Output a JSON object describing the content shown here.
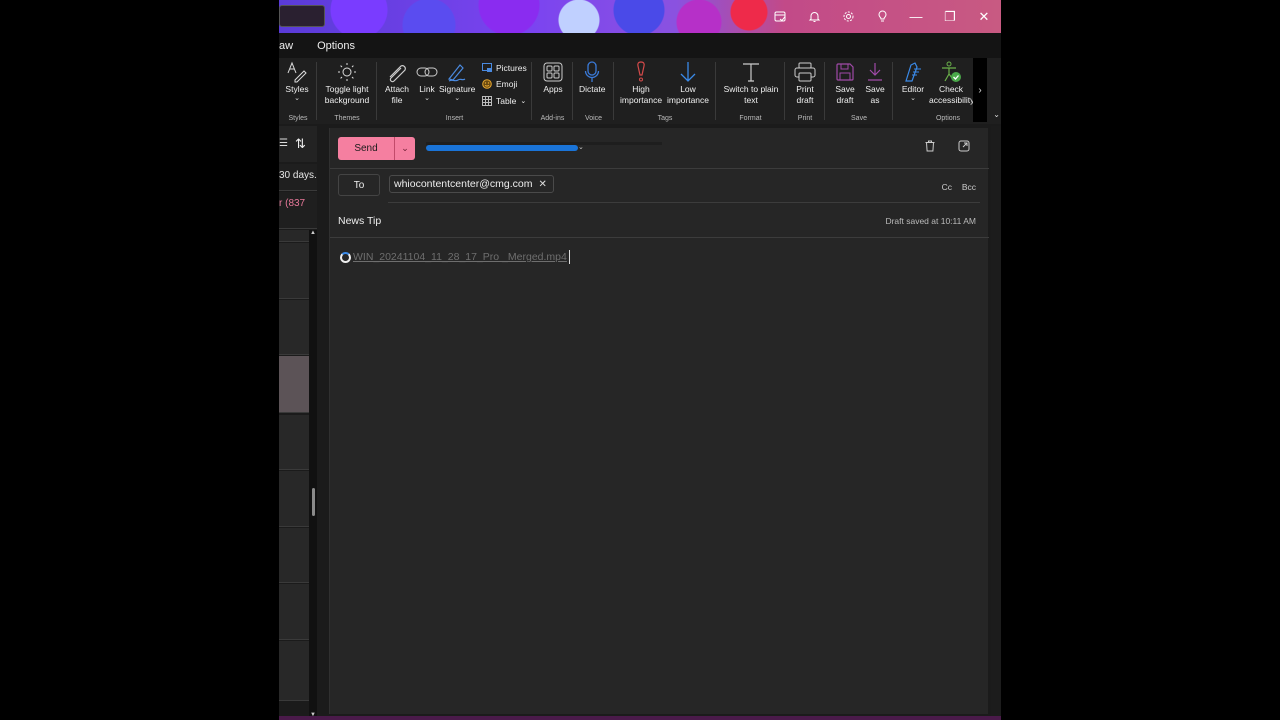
{
  "titlebar": {
    "icons": [
      {
        "name": "my-day-icon",
        "glyph": "✎"
      },
      {
        "name": "bell-icon",
        "glyph": "🔔"
      },
      {
        "name": "gear-icon",
        "glyph": "⚙"
      },
      {
        "name": "lightbulb-icon",
        "glyph": "💡"
      }
    ],
    "window_controls": {
      "minimize": "—",
      "restore": "❐",
      "close": "✕"
    }
  },
  "menubar": {
    "tabs": [
      "aw",
      "Options"
    ]
  },
  "ribbon": {
    "groups": [
      {
        "label": "Styles",
        "buttons": [
          {
            "label": "Styles",
            "icon": "styles-icon",
            "dropdown": true
          }
        ]
      },
      {
        "label": "Themes",
        "buttons": [
          {
            "label": "Toggle light background",
            "icon": "sun-icon"
          }
        ]
      },
      {
        "label": "Insert",
        "buttons": [
          {
            "label": "Attach file",
            "icon": "paperclip-icon",
            "dropdown": true
          },
          {
            "label": "Link",
            "icon": "link-icon",
            "dropdown": true
          },
          {
            "label": "Signature",
            "icon": "signature-icon",
            "dropdown": true
          },
          {
            "label": "Pictures",
            "icon": "picture-icon"
          },
          {
            "label": "Emoji",
            "icon": "emoji-icon"
          },
          {
            "label": "Table",
            "icon": "table-icon",
            "dropdown": true
          }
        ]
      },
      {
        "label": "Add-ins",
        "buttons": [
          {
            "label": "Apps",
            "icon": "apps-icon"
          }
        ]
      },
      {
        "label": "Voice",
        "buttons": [
          {
            "label": "Dictate",
            "icon": "microphone-icon"
          }
        ]
      },
      {
        "label": "Tags",
        "buttons": [
          {
            "label": "High importance",
            "icon": "exclamation-icon"
          },
          {
            "label": "Low importance",
            "icon": "arrow-down-icon"
          }
        ]
      },
      {
        "label": "Format",
        "buttons": [
          {
            "label": "Switch to plain text",
            "icon": "text-icon"
          }
        ]
      },
      {
        "label": "Print",
        "buttons": [
          {
            "label": "Print draft",
            "icon": "printer-icon"
          }
        ]
      },
      {
        "label": "Save",
        "buttons": [
          {
            "label": "Save draft",
            "icon": "save-icon"
          },
          {
            "label": "Save as",
            "icon": "download-icon"
          }
        ]
      },
      {
        "label": "Options",
        "buttons": [
          {
            "label": "Editor",
            "icon": "editor-pen-icon",
            "dropdown": true
          },
          {
            "label": "Check accessibility",
            "icon": "accessibility-icon"
          }
        ]
      }
    ],
    "more_glyph": "›",
    "expand_glyph": "⌄"
  },
  "message_list": {
    "sort_glyph": "⇅",
    "filter_glyph": "☰",
    "items": [
      {
        "text": "30 days.",
        "color": "#e6e6e6"
      },
      {
        "text": "r (837",
        "color": "#e8789a"
      },
      {
        "text": ""
      },
      {
        "text": ""
      },
      {
        "text": ""
      },
      {
        "text": "",
        "selected": true
      },
      {
        "text": ""
      },
      {
        "text": ""
      },
      {
        "text": ""
      },
      {
        "text": ""
      },
      {
        "text": ""
      }
    ]
  },
  "compose": {
    "send_label": "Send",
    "send_dropdown_glyph": "⌄",
    "to_label": "To",
    "recipients": [
      "whiocontentcenter@cmg.com"
    ],
    "remove_glyph": "✕",
    "cc_label": "Cc",
    "bcc_label": "Bcc",
    "subject": "News Tip",
    "draft_status": "Draft saved at 10:11 AM",
    "attachment": {
      "name": "WIN_20241104_11_28_17_Pro _Merged.mp4",
      "status": "uploading"
    },
    "delete_glyph": "🗑",
    "popout_glyph": "⧉"
  },
  "colors": {
    "accent_send": "#f57fa0",
    "from_redaction": "#1a74d8"
  }
}
